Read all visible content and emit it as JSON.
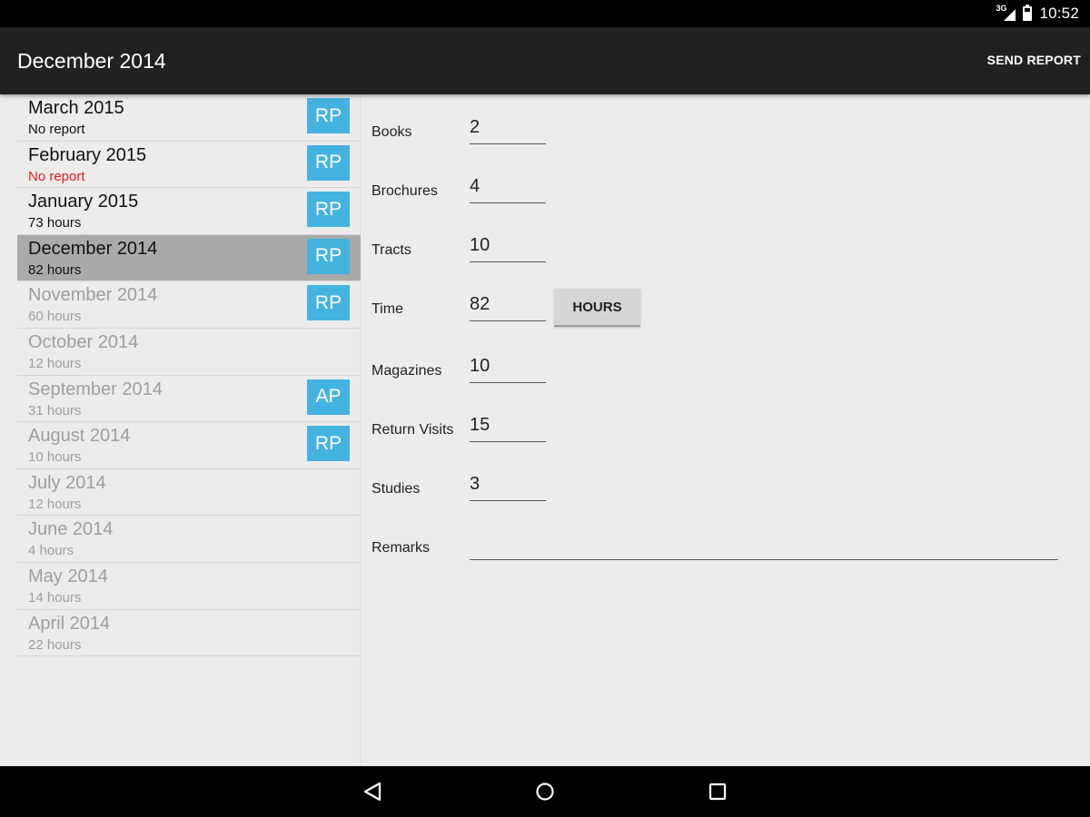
{
  "status_bar": {
    "network": "3G",
    "time": "10:52"
  },
  "action_bar": {
    "title": "December 2014",
    "send_report": "SEND REPORT"
  },
  "months": [
    {
      "name": "March 2015",
      "sub": "No report",
      "badge": "RP",
      "state": "active",
      "sub_color": "normal"
    },
    {
      "name": "February 2015",
      "sub": "No report",
      "badge": "RP",
      "state": "active",
      "sub_color": "red"
    },
    {
      "name": "January 2015",
      "sub": "73 hours",
      "badge": "RP",
      "state": "active",
      "sub_color": "normal"
    },
    {
      "name": "December 2014",
      "sub": "82 hours",
      "badge": "RP",
      "state": "active",
      "selected": true,
      "sub_color": "normal"
    },
    {
      "name": "November 2014",
      "sub": "60 hours",
      "badge": "RP",
      "state": "inactive",
      "sub_color": "normal"
    },
    {
      "name": "October 2014",
      "sub": "12 hours",
      "badge": "",
      "state": "inactive",
      "sub_color": "normal"
    },
    {
      "name": "September 2014",
      "sub": "31 hours",
      "badge": "AP",
      "state": "inactive",
      "sub_color": "normal"
    },
    {
      "name": "August 2014",
      "sub": "10 hours",
      "badge": "RP",
      "state": "inactive",
      "sub_color": "normal"
    },
    {
      "name": "July 2014",
      "sub": "12 hours",
      "badge": "",
      "state": "inactive",
      "sub_color": "normal"
    },
    {
      "name": "June 2014",
      "sub": "4 hours",
      "badge": "",
      "state": "inactive",
      "sub_color": "normal"
    },
    {
      "name": "May 2014",
      "sub": "14 hours",
      "badge": "",
      "state": "inactive",
      "sub_color": "normal"
    },
    {
      "name": "April 2014",
      "sub": "22 hours",
      "badge": "",
      "state": "inactive",
      "sub_color": "normal"
    }
  ],
  "form": {
    "books": {
      "label": "Books",
      "value": "2"
    },
    "brochures": {
      "label": "Brochures",
      "value": "4"
    },
    "tracts": {
      "label": "Tracts",
      "value": "10"
    },
    "time": {
      "label": "Time",
      "value": "82",
      "button": "HOURS"
    },
    "magazines": {
      "label": "Magazines",
      "value": "10"
    },
    "return_visits": {
      "label": "Return Visits",
      "value": "15"
    },
    "studies": {
      "label": "Studies",
      "value": "3"
    },
    "remarks": {
      "label": "Remarks",
      "value": ""
    }
  },
  "colors": {
    "badge": "#45b3e0",
    "selected_row": "#aaaaaa",
    "no_report_red": "#e41b1b",
    "action_bar": "#212121"
  },
  "icons": {
    "back": "back-triangle-icon",
    "home": "home-circle-icon",
    "recents": "recents-square-icon"
  }
}
